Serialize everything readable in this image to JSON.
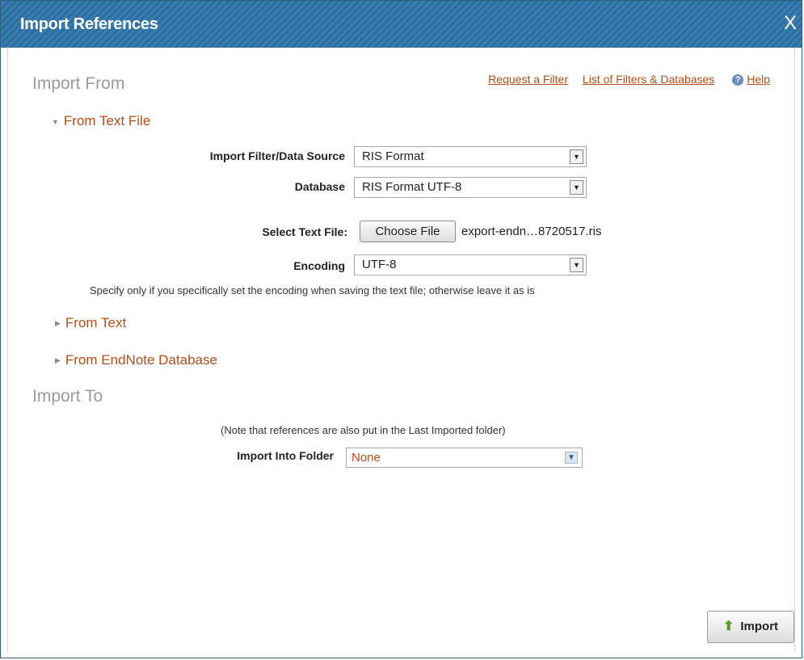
{
  "dialog": {
    "title": "Import References",
    "close_label": "X"
  },
  "import_from": {
    "heading": "Import From",
    "links": {
      "request_filter": "Request a Filter",
      "list_filters": "List of Filters & Databases",
      "help": "Help"
    },
    "from_text_file": {
      "label": "From Text File",
      "filter_label": "Import Filter/Data Source",
      "filter_value": "RIS Format",
      "database_label": "Database",
      "database_value": "RIS Format UTF-8",
      "select_file_label": "Select Text File:",
      "choose_file_label": "Choose File",
      "file_name": "export-endn…8720517.ris",
      "encoding_label": "Encoding",
      "encoding_value": "UTF-8",
      "encoding_note": "Specify only if you specifically set the encoding when saving the text file; otherwise leave it as is"
    },
    "from_text": {
      "label": "From Text"
    },
    "from_endnote": {
      "label": "From EndNote Database"
    }
  },
  "import_to": {
    "heading": "Import To",
    "note": "(Note that references are also put in the Last Imported folder)",
    "folder_label": "Import Into Folder",
    "folder_value": "None"
  },
  "actions": {
    "import_label": "Import"
  },
  "icons": {
    "help": "help-icon",
    "close": "close-icon",
    "expanded": "caret-down-icon",
    "collapsed": "caret-right-icon",
    "import": "up-arrow-icon"
  },
  "colors": {
    "title_bar": "#2d6ea0",
    "link": "#b24e16"
  }
}
